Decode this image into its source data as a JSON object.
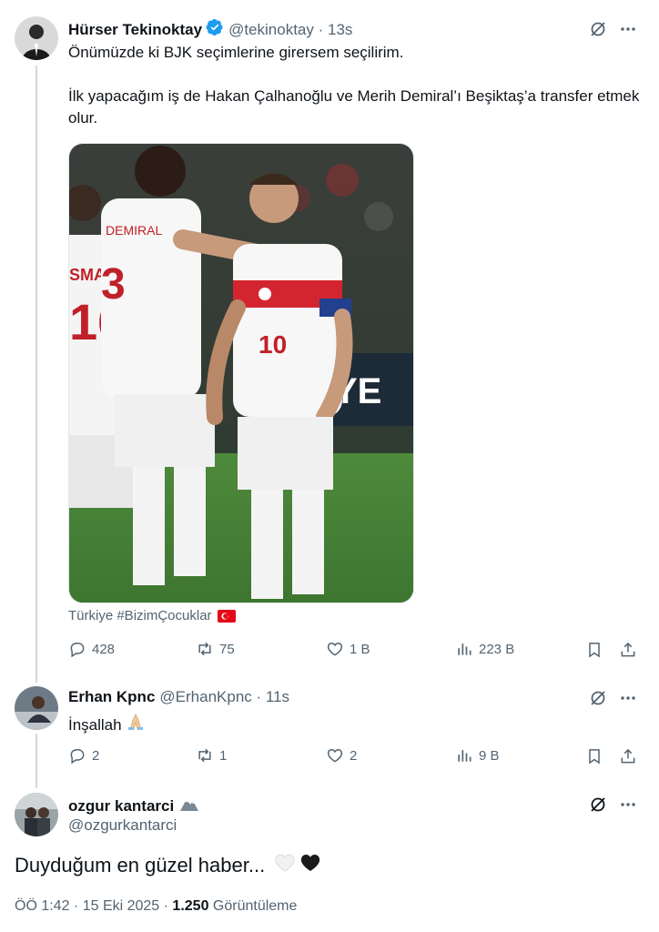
{
  "tweet1": {
    "name": "Hürser Tekinoktay",
    "handle": "@tekinoktay · 13s",
    "line1": "Önümüzde ki BJK seçimlerine girersem seçilirim.",
    "line2": "İlk yapacağım iş de Hakan Çalhanoğlu ve Merih Demiral’ı Beşiktaş’a transfer etmek olur.",
    "tag": "Türkiye #BizimÇocuklar",
    "replies": "428",
    "reposts": "75",
    "likes": "1 B",
    "views": "223 B"
  },
  "tweet2": {
    "name": "Erhan Kpnc",
    "handle": "@ErhanKpnc · 11s",
    "text": "İnşallah",
    "replies": "2",
    "reposts": "1",
    "likes": "2",
    "views": "9 B"
  },
  "tweet3": {
    "name": "ozgur kantarci",
    "handle": "@ozgurkantarci",
    "text": "Duyduğum en güzel haber...",
    "time": "ÖÖ 1:42 · 15 Eki 2025 · ",
    "views_count": "1.250",
    "views_label": " Görüntüleme"
  },
  "icons": {
    "grok": "grok-icon",
    "more": "more-icon",
    "reply": "reply-icon",
    "repost": "repost-icon",
    "like": "heart-icon",
    "views": "views-icon",
    "bookmark": "bookmark-icon",
    "share": "share-icon"
  },
  "colors": {
    "text": "#0f1419",
    "secondary": "#536471",
    "verified": "#1d9bf0",
    "thread_line": "#cfd9de"
  }
}
